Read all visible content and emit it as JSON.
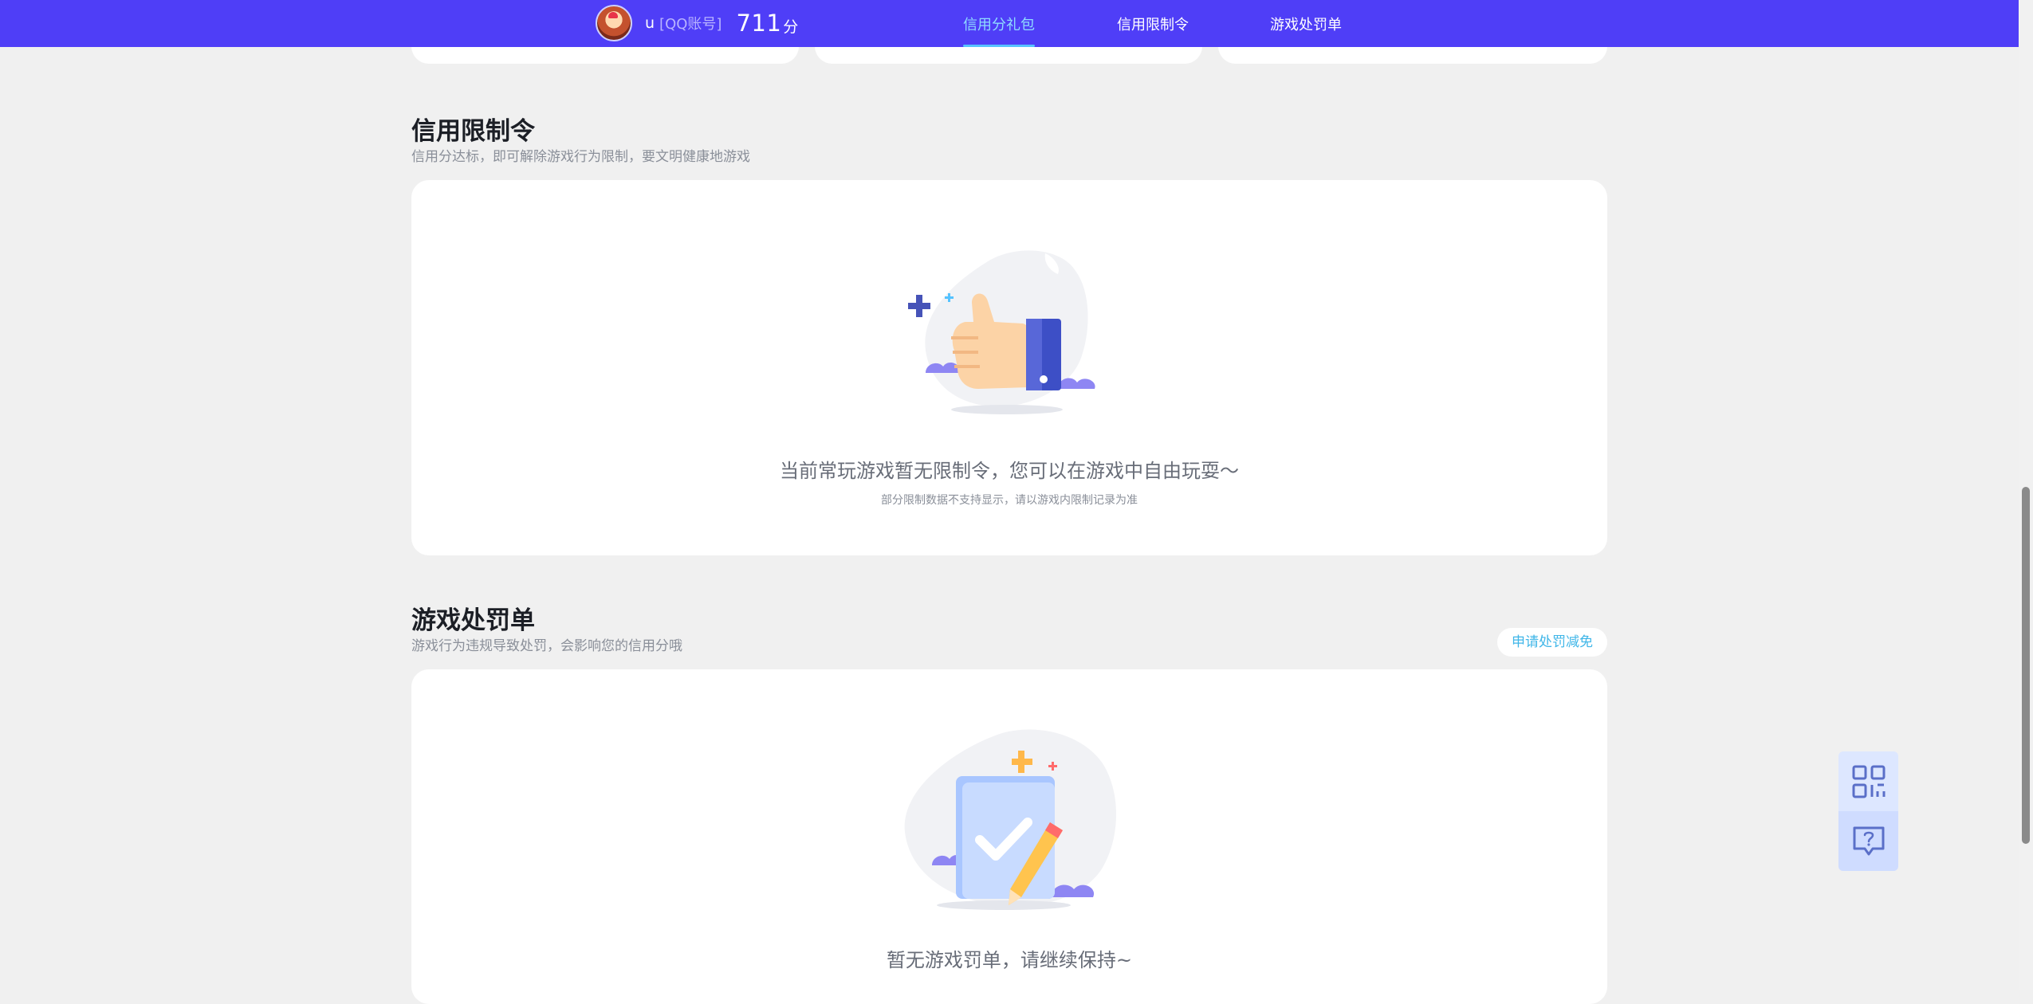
{
  "header": {
    "user": {
      "name": "u",
      "account_type": "[QQ账号]",
      "score": "711",
      "score_unit": "分"
    },
    "tabs": [
      {
        "label": "信用分礼包",
        "active": true
      },
      {
        "label": "信用限制令",
        "active": false
      },
      {
        "label": "游戏处罚单",
        "active": false
      }
    ]
  },
  "restriction_section": {
    "title": "信用限制令",
    "subtitle": "信用分达标，即可解除游戏行为限制，要文明健康地游戏",
    "empty_title": "当前常玩游戏暂无限制令，您可以在游戏中自由玩耍～",
    "empty_note": "部分限制数据不支持显示，请以游戏内限制记录为准"
  },
  "penalty_section": {
    "title": "游戏处罚单",
    "subtitle": "游戏行为违规导致处罚，会影响您的信用分哦",
    "appeal_label": "申请处罚减免",
    "empty_title": "暂无游戏罚单，请继续保持~"
  },
  "colors": {
    "brand": "#4f3ef7",
    "active_tab": "#8fdcff",
    "accent_link": "#3fb6e8",
    "page_bg": "#f0f0f0"
  },
  "icons": {
    "float_tools": [
      "qr-code-icon",
      "help-chat-icon"
    ]
  }
}
